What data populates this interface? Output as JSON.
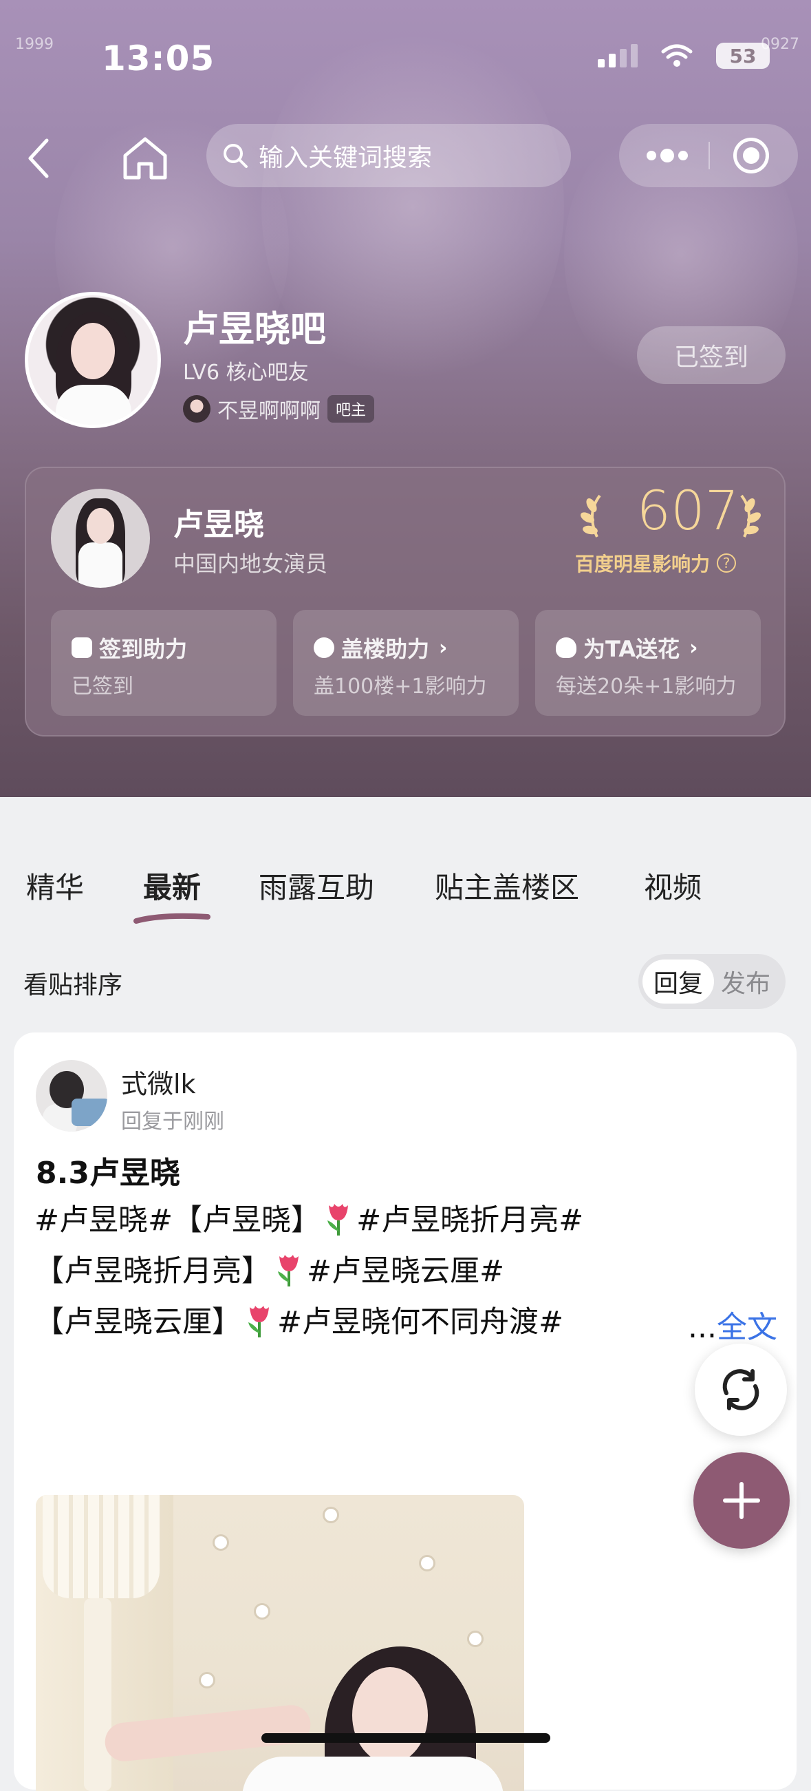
{
  "status_bar": {
    "time": "13:05",
    "battery": "53"
  },
  "decor": {
    "left_num": "1999",
    "right_num": "0927"
  },
  "nav": {
    "search_placeholder": "输入关键词搜索"
  },
  "forum": {
    "title": "卢昱晓吧",
    "level": "LV6 核心吧友",
    "owner_name": "不昱啊啊啊",
    "owner_badge": "吧主",
    "checkin_label": "已签到"
  },
  "star": {
    "name": "卢昱晓",
    "description": "中国内地女演员",
    "influence_value": "607",
    "influence_label": "百度明星影响力",
    "influence_help": "?"
  },
  "boost_cards": [
    {
      "title": "签到助力",
      "subtitle": "已签到"
    },
    {
      "title": "盖楼助力",
      "subtitle": "盖100楼+1影响力"
    },
    {
      "title": "为TA送花",
      "subtitle": "每送20朵+1影响力"
    }
  ],
  "tabs": [
    {
      "label": "精华"
    },
    {
      "label": "最新"
    },
    {
      "label": "雨露互助"
    },
    {
      "label": "贴主盖楼区"
    },
    {
      "label": "视频"
    }
  ],
  "sort": {
    "label": "看贴排序",
    "option_reply": "回复",
    "option_publish": "发布"
  },
  "post": {
    "username": "式微lk",
    "time": "回复于刚刚",
    "title": "8.3卢昱晓",
    "line1_a": "#卢昱晓#【卢昱晓】",
    "line1_b": "#卢昱晓折月亮#",
    "line2_a": "【卢昱晓折月亮】",
    "line2_b": "#卢昱晓云厘#",
    "line3_a": "【卢昱晓云厘】",
    "line3_b": "#卢昱晓何不同舟渡#",
    "ellipsis": "...",
    "full_text": "全文"
  },
  "icons": {
    "back": "chevron-left-icon",
    "home": "home-icon",
    "search": "search-icon",
    "more": "more-dots-icon",
    "target": "target-icon",
    "refresh": "refresh-icon",
    "add": "plus-icon",
    "tulip": "tulip-emoji"
  },
  "colors": {
    "accent_purple": "#8e5a73",
    "gold": "#f3d08d",
    "link_blue": "#3b73e6",
    "underline": "#8e5a73"
  }
}
